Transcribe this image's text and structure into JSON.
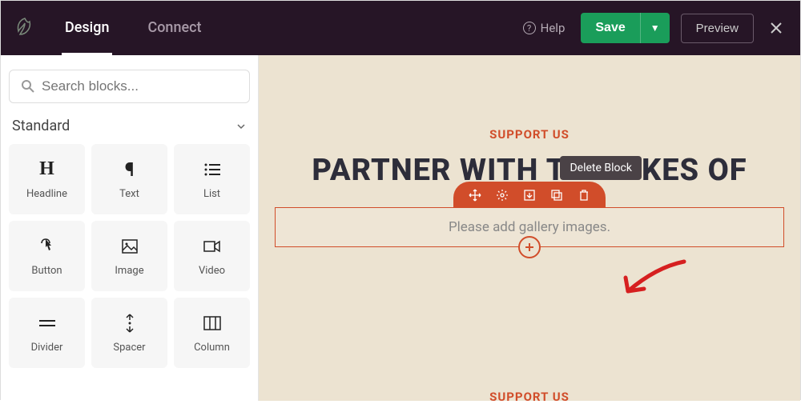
{
  "topbar": {
    "tabs": [
      "Design",
      "Connect"
    ],
    "help": "Help",
    "save": "Save",
    "preview": "Preview"
  },
  "sidebar": {
    "search_placeholder": "Search blocks...",
    "section": "Standard",
    "blocks": [
      {
        "label": "Headline",
        "icon": "H"
      },
      {
        "label": "Text",
        "icon": "¶"
      },
      {
        "label": "List",
        "icon": "≣"
      },
      {
        "label": "Button",
        "icon": "btn"
      },
      {
        "label": "Image",
        "icon": "img"
      },
      {
        "label": "Video",
        "icon": "vid"
      },
      {
        "label": "Divider",
        "icon": "div"
      },
      {
        "label": "Spacer",
        "icon": "spc"
      },
      {
        "label": "Column",
        "icon": "col"
      }
    ]
  },
  "canvas": {
    "eyebrow": "SUPPORT US",
    "headline": "PARTNER WITH THE LIKES OF",
    "placeholder": "Please add gallery images.",
    "tooltip": "Delete Block",
    "eyebrow2": "SUPPORT US"
  },
  "colors": {
    "accent": "#d14d2a",
    "topbar": "#261526",
    "save": "#1a9d5a",
    "canvas": "#ece3d1"
  }
}
